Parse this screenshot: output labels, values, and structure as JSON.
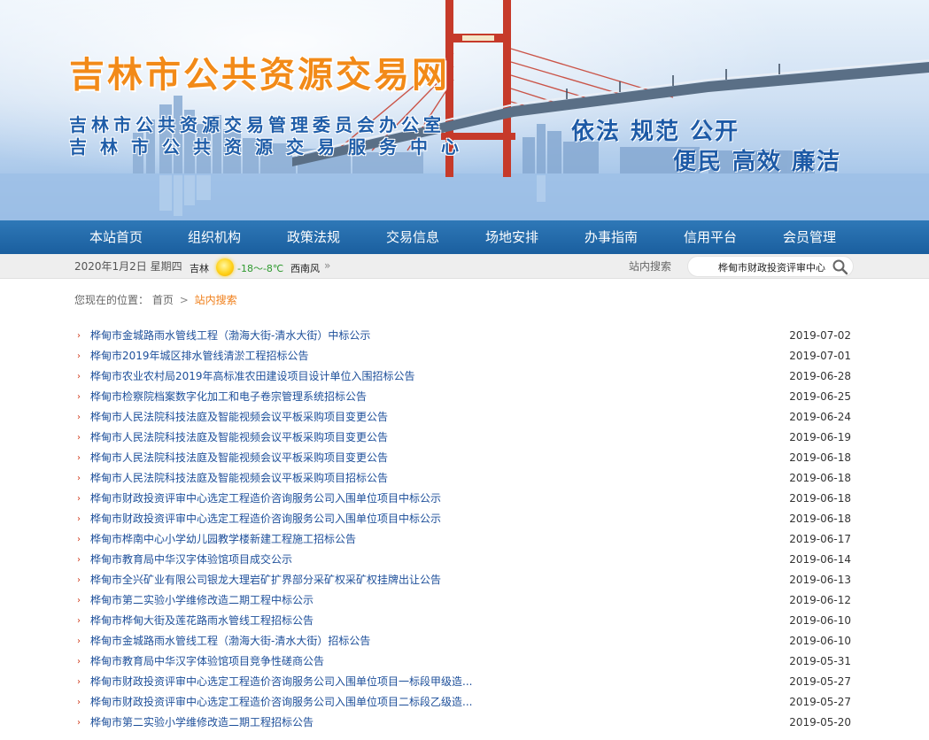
{
  "banner": {
    "site_title": "吉林市公共资源交易网",
    "org_line1": "吉林市公共资源交易管理委员会办公室",
    "org_line2": "吉林市公共资源交易服务中心",
    "motto_line1": "依法 规范 公开",
    "motto_line2": "便民 高效 廉洁"
  },
  "nav": {
    "items": [
      {
        "label": "本站首页"
      },
      {
        "label": "组织机构"
      },
      {
        "label": "政策法规"
      },
      {
        "label": "交易信息"
      },
      {
        "label": "场地安排"
      },
      {
        "label": "办事指南"
      },
      {
        "label": "信用平台"
      },
      {
        "label": "会员管理"
      }
    ]
  },
  "infobar": {
    "date": "2020年1月2日 星期四",
    "city": "吉林",
    "weather_icon": "sun-icon",
    "temperature": "-18～-8℃",
    "wind": "西南风",
    "search_label": "站内搜索",
    "search_value": "桦甸市财政投资评审中心"
  },
  "breadcrumb": {
    "prefix": "您现在的位置：",
    "home": "首页",
    "separator": ">",
    "current": "站内搜索"
  },
  "results": [
    {
      "title": "桦甸市金城路雨水管线工程（渤海大街-清水大街）中标公示",
      "date": "2019-07-02"
    },
    {
      "title": "桦甸市2019年城区排水管线清淤工程招标公告",
      "date": "2019-07-01"
    },
    {
      "title": "桦甸市农业农村局2019年高标准农田建设项目设计单位入围招标公告",
      "date": "2019-06-28"
    },
    {
      "title": "桦甸市检察院档案数字化加工和电子卷宗管理系统招标公告",
      "date": "2019-06-25"
    },
    {
      "title": "桦甸市人民法院科技法庭及智能视频会议平板采购项目变更公告",
      "date": "2019-06-24"
    },
    {
      "title": "桦甸市人民法院科技法庭及智能视频会议平板采购项目变更公告",
      "date": "2019-06-19"
    },
    {
      "title": "桦甸市人民法院科技法庭及智能视频会议平板采购项目变更公告",
      "date": "2019-06-18"
    },
    {
      "title": "桦甸市人民法院科技法庭及智能视频会议平板采购项目招标公告",
      "date": "2019-06-18"
    },
    {
      "title": "桦甸市财政投资评审中心选定工程造价咨询服务公司入围单位项目中标公示",
      "date": "2019-06-18"
    },
    {
      "title": "桦甸市财政投资评审中心选定工程造价咨询服务公司入围单位项目中标公示",
      "date": "2019-06-18"
    },
    {
      "title": "桦甸市桦南中心小学幼儿园教学楼新建工程施工招标公告",
      "date": "2019-06-17"
    },
    {
      "title": "桦甸市教育局中华汉字体验馆项目成交公示",
      "date": "2019-06-14"
    },
    {
      "title": "桦甸市全兴矿业有限公司银龙大理岩矿扩界部分采矿权采矿权挂牌出让公告",
      "date": "2019-06-13"
    },
    {
      "title": "桦甸市第二实验小学维修改造二期工程中标公示",
      "date": "2019-06-12"
    },
    {
      "title": "桦甸市桦甸大街及莲花路雨水管线工程招标公告",
      "date": "2019-06-10"
    },
    {
      "title": "桦甸市金城路雨水管线工程（渤海大街-清水大街）招标公告",
      "date": "2019-06-10"
    },
    {
      "title": "桦甸市教育局中华汉字体验馆项目竞争性磋商公告",
      "date": "2019-05-31"
    },
    {
      "title": "桦甸市财政投资评审中心选定工程造价咨询服务公司入围单位项目一标段甲级造...",
      "date": "2019-05-27"
    },
    {
      "title": "桦甸市财政投资评审中心选定工程造价咨询服务公司入围单位项目二标段乙级造...",
      "date": "2019-05-27"
    },
    {
      "title": "桦甸市第二实验小学维修改造二期工程招标公告",
      "date": "2019-05-20"
    }
  ],
  "colors": {
    "nav_bg": "#1a5f9f",
    "title_orange": "#f28a18",
    "link_blue": "#1d4f9a",
    "bullet_red": "#d03a1a",
    "breadcrumb_current": "#f07f1a"
  }
}
